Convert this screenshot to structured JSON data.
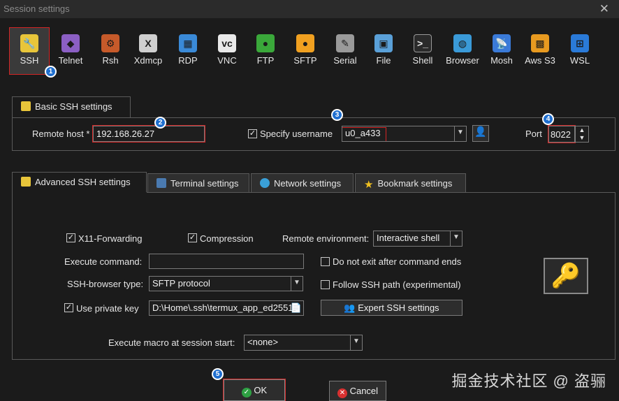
{
  "window": {
    "title": "Session settings"
  },
  "protocols": [
    {
      "label": "SSH",
      "icon": "ssh-icon",
      "color": "#e8c53a",
      "glyph": "🔧",
      "selected": true
    },
    {
      "label": "Telnet",
      "icon": "telnet-icon",
      "color": "#8b5fc4",
      "glyph": "◆"
    },
    {
      "label": "Rsh",
      "icon": "rsh-icon",
      "color": "#c65a2a",
      "glyph": "⚙"
    },
    {
      "label": "Xdmcp",
      "icon": "xdmcp-icon",
      "color": "#cfcfcf",
      "glyph": "X"
    },
    {
      "label": "RDP",
      "icon": "rdp-icon",
      "color": "#3a8ad8",
      "glyph": "▦"
    },
    {
      "label": "VNC",
      "icon": "vnc-icon",
      "color": "#e9e9e9",
      "glyph": "vc"
    },
    {
      "label": "FTP",
      "icon": "ftp-icon",
      "color": "#3aa83a",
      "glyph": "●"
    },
    {
      "label": "SFTP",
      "icon": "sftp-icon",
      "color": "#f0a020",
      "glyph": "●"
    },
    {
      "label": "Serial",
      "icon": "serial-icon",
      "color": "#9a9a9a",
      "glyph": "✎"
    },
    {
      "label": "File",
      "icon": "file-icon",
      "color": "#5aa0d8",
      "glyph": "▣"
    },
    {
      "label": "Shell",
      "icon": "shell-icon",
      "color": "#2a2a2a",
      "glyph": ">_"
    },
    {
      "label": "Browser",
      "icon": "browser-icon",
      "color": "#3a9ad8",
      "glyph": "◍"
    },
    {
      "label": "Mosh",
      "icon": "mosh-icon",
      "color": "#3a7ad8",
      "glyph": "📡"
    },
    {
      "label": "Aws S3",
      "icon": "aws-s3-icon",
      "color": "#e89a20",
      "glyph": "▩"
    },
    {
      "label": "WSL",
      "icon": "wsl-icon",
      "color": "#2a7ad8",
      "glyph": "⊞"
    }
  ],
  "badges": [
    "1",
    "2",
    "3",
    "4",
    "5"
  ],
  "basic": {
    "tab_label": "Basic SSH settings",
    "remote_host_label": "Remote host *",
    "remote_host_value": "192.168.26.27",
    "specify_username_label": "Specify username",
    "specify_username_checked": true,
    "username_value": "u0_a433",
    "port_label": "Port",
    "port_value": "8022"
  },
  "tabs": [
    {
      "label": "Advanced SSH settings",
      "active": true
    },
    {
      "label": "Terminal settings"
    },
    {
      "label": "Network settings"
    },
    {
      "label": "Bookmark settings"
    }
  ],
  "advanced": {
    "x11_label": "X11-Forwarding",
    "compression_label": "Compression",
    "remote_env_label": "Remote environment:",
    "remote_env_value": "Interactive shell",
    "execute_command_label": "Execute command:",
    "execute_command_value": "",
    "do_not_exit_label": "Do not exit after command ends",
    "ssh_browser_label": "SSH-browser type:",
    "ssh_browser_value": "SFTP protocol",
    "follow_ssh_label": "Follow SSH path (experimental)",
    "use_private_key_label": "Use private key",
    "private_key_value": "D:\\Home\\.ssh\\termux_app_ed2551",
    "expert_label": "Expert SSH settings",
    "macro_label": "Execute macro at session start:",
    "macro_value": "<none>"
  },
  "footer": {
    "ok_label": "OK",
    "cancel_label": "Cancel"
  },
  "watermark": "掘金技术社区 @ 盗骊"
}
